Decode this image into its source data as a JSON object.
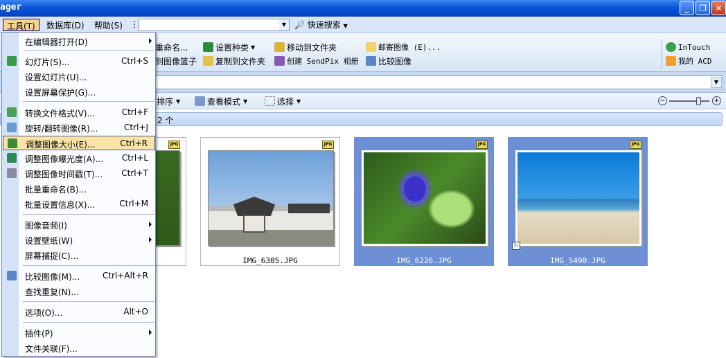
{
  "window": {
    "title": "ager",
    "btn_min": "_",
    "btn_max": "❐",
    "btn_close": "✕"
  },
  "menubar": {
    "tools": "工具(T)",
    "database": "数据库(D)",
    "help": "帮助(S)",
    "more": "⋮",
    "quick_search": "快速搜索"
  },
  "toolbar": {
    "rename": "重命名...",
    "tag_set": "设置种类",
    "move_to": "移动到文件夹",
    "mail": "邮寄图像 (E)...",
    "intouch": "InTouch",
    "basket": "到图像篮子",
    "copy_to": "复制到文件夹",
    "create_sendpix": "创建 SendPix 相册",
    "compare": "比较图像",
    "my_acd": "我的 ACD"
  },
  "viewbar": {
    "sort": "排序",
    "view_mode": "查看模式",
    "select": "选择"
  },
  "status": {
    "count": "2 个"
  },
  "thumbs": [
    {
      "name": "",
      "badge": "JPG"
    },
    {
      "name": "IMG_6305.JPG",
      "badge": "JPG"
    },
    {
      "name": "IMG_6226.JPG",
      "badge": "JPG"
    },
    {
      "name": "IMG_5490.JPG",
      "badge": "JPG"
    }
  ],
  "menu": {
    "items": [
      {
        "label": "在编辑器打开(D)",
        "shortcut": ""
      },
      {
        "label": "幻灯片(S)...",
        "shortcut": "Ctrl+S"
      },
      {
        "label": "设置幻灯片(U)...",
        "shortcut": ""
      },
      {
        "label": "设置屏幕保护(G)...",
        "shortcut": ""
      },
      {
        "label": "转换文件格式(V)...",
        "shortcut": "Ctrl+F"
      },
      {
        "label": "旋转/翻转图像(R)...",
        "shortcut": "Ctrl+J"
      },
      {
        "label": "调整图像大小(E)...",
        "shortcut": "Ctrl+R"
      },
      {
        "label": "调整图像曝光度(A)...",
        "shortcut": "Ctrl+L"
      },
      {
        "label": "调整图像时间戳(T)...",
        "shortcut": "Ctrl+T"
      },
      {
        "label": "批量重命名(B)...",
        "shortcut": ""
      },
      {
        "label": "批量设置信息(X)...",
        "shortcut": "Ctrl+M"
      },
      {
        "label": "图像音频(I)",
        "shortcut": ""
      },
      {
        "label": "设置壁纸(W)",
        "shortcut": ""
      },
      {
        "label": "屏幕捕捉(C)...",
        "shortcut": ""
      },
      {
        "label": "比较图像(M)...",
        "shortcut": "Ctrl+Alt+R"
      },
      {
        "label": "查找重复(N)...",
        "shortcut": ""
      },
      {
        "label": "选项(O)...",
        "shortcut": "Alt+O"
      },
      {
        "label": "插件(P)",
        "shortcut": ""
      },
      {
        "label": "文件关联(F)...",
        "shortcut": ""
      }
    ]
  },
  "colors": {
    "accent": "#0a56d8",
    "highlight": "#fbe3a7",
    "selection": "#6d8fd6"
  }
}
